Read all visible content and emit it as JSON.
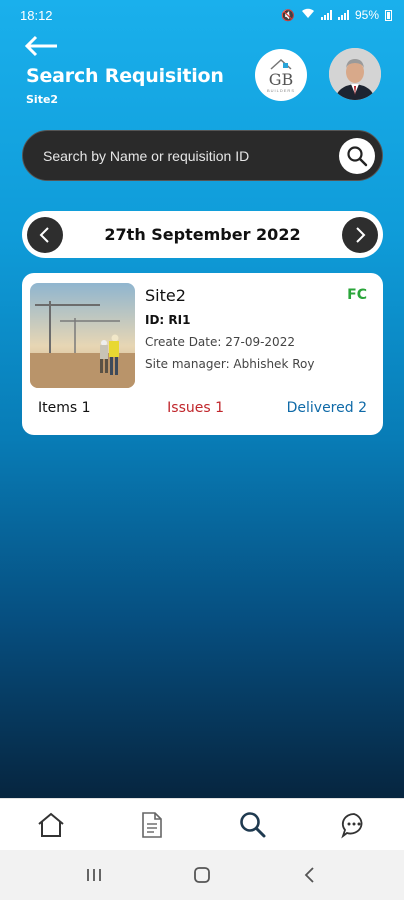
{
  "status_bar": {
    "time": "18:12",
    "battery": "95%",
    "network1": "VoLTE LTE1",
    "network2": "VoLTE LTE2"
  },
  "header": {
    "title": "Search Requisition",
    "subtitle": "Site2",
    "logo_text": "GB",
    "logo_sub": "BUILDERS"
  },
  "search": {
    "placeholder": "Search by Name or requisition ID",
    "value": ""
  },
  "date_nav": {
    "date": "27th September 2022"
  },
  "requisitions": [
    {
      "site": "Site2",
      "badge": "FC",
      "id": "ID: RI1",
      "create_date": "Create Date: 27-09-2022",
      "manager": "Site manager: Abhishek Roy",
      "items": "Items 1",
      "issues": "Issues 1",
      "delivered": "Delivered 2"
    }
  ],
  "bottom_nav": [
    "home-icon",
    "document-icon",
    "search-icon",
    "chat-icon"
  ],
  "colors": {
    "accent": "#1ab0ec",
    "fc_green": "#2aa53a",
    "issues_red": "#c0262b",
    "delivered_blue": "#0f6aa8"
  }
}
